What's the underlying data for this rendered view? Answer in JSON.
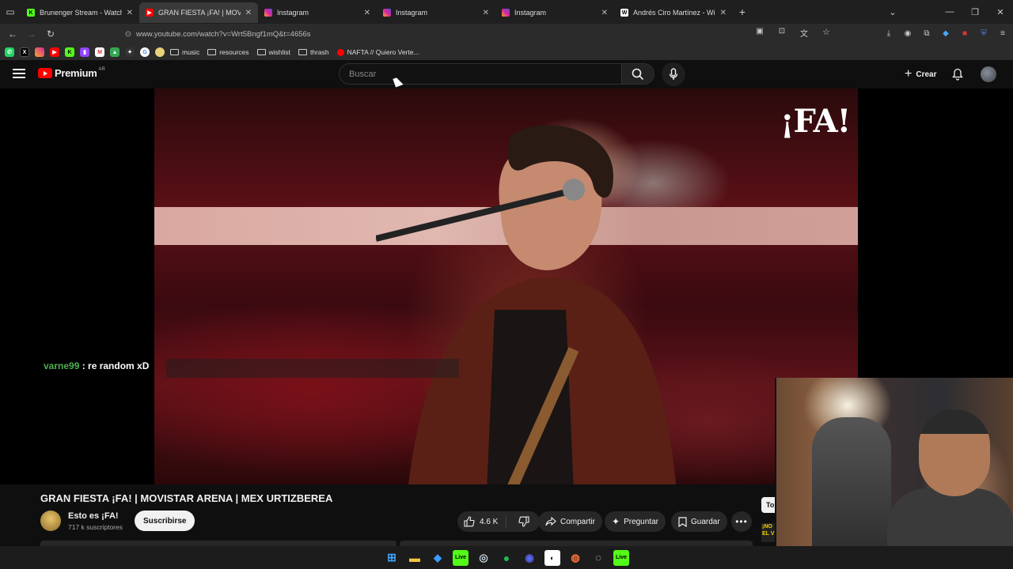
{
  "browser": {
    "tabs": [
      {
        "title": "Brunenger Stream - Watch",
        "active": false,
        "favicon": "kick-icon",
        "favicon_color": "#53fc18"
      },
      {
        "title": "GRAN FIESTA ¡FA! | MOVISTAR A",
        "active": true,
        "favicon": "youtube-icon",
        "favicon_color": "#ff0000"
      },
      {
        "title": "Instagram",
        "active": false,
        "favicon": "instagram-icon",
        "favicon_color": "#d6249f"
      },
      {
        "title": "Instagram",
        "active": false,
        "favicon": "instagram-icon",
        "favicon_color": "#d6249f"
      },
      {
        "title": "Instagram",
        "active": false,
        "favicon": "instagram-icon",
        "favicon_color": "#d6249f"
      },
      {
        "title": "Andrés Ciro Martínez - Wikipedi",
        "active": false,
        "favicon": "wikipedia-icon",
        "favicon_color": "#ffffff"
      }
    ],
    "url": "www.youtube.com/watch?v=Wrt5Bngf1mQ&t=4656s",
    "bookmarks": {
      "folders": [
        "music",
        "resources",
        "wishlist",
        "thrash"
      ],
      "last": "NAFTA // Quiero Verte..."
    }
  },
  "youtube": {
    "logo_text": "Premium",
    "country": "AR",
    "search_placeholder": "Buscar",
    "create_label": "Crear",
    "video": {
      "watermark": "¡FA!",
      "chat_user": "varne99",
      "chat_message": " : re random xD"
    },
    "title": "GRAN FIESTA ¡FA! | MOVISTAR ARENA | MEX URTIZBEREA",
    "channel": {
      "name": "Esto es ¡FA!",
      "subscribers": "717 k suscriptores"
    },
    "subscribe_label": "Suscribirse",
    "likes": "4.6 K",
    "share_label": "Compartir",
    "ask_label": "Preguntar",
    "save_label": "Guardar",
    "side_chip": "To",
    "side_thumb_text": "¡NO EL V"
  },
  "colors": {
    "brand": "#ff0000",
    "bg": "#0f0f0f",
    "chat_user": "#4caf50"
  }
}
